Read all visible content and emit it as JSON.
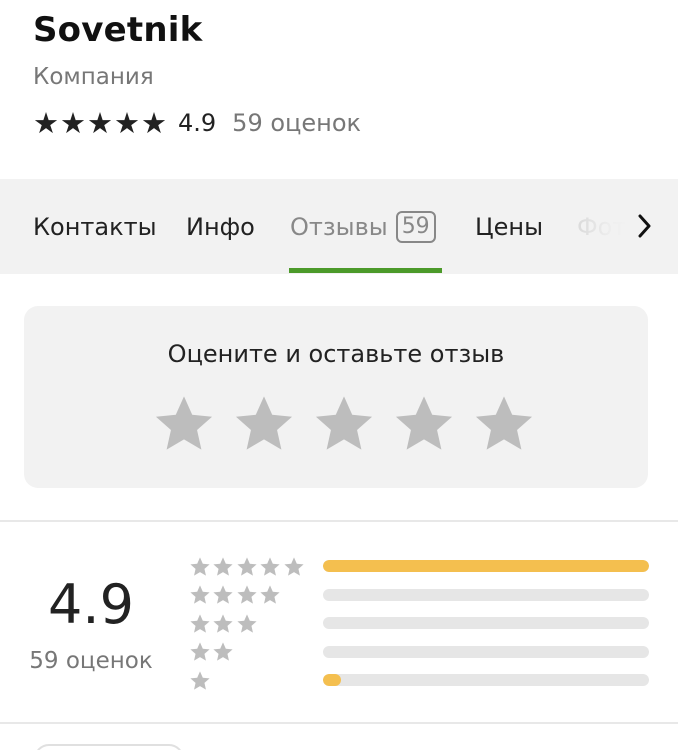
{
  "company": {
    "name": "Sovetnik",
    "category": "Компания",
    "rating": "4.9",
    "ratings_count_label": "59 оценок"
  },
  "tabs": [
    {
      "label": "Контакты",
      "active": false
    },
    {
      "label": "Инфо",
      "active": false
    },
    {
      "label": "Отзывы",
      "badge": "59",
      "active": true
    },
    {
      "label": "Цены",
      "active": false
    },
    {
      "label": "Фото",
      "active": false
    }
  ],
  "rate_prompt": {
    "title": "Оцените и оставьте отзыв",
    "stars": 5
  },
  "summary": {
    "rating": "4.9",
    "count_label": "59 оценок"
  },
  "distribution": [
    {
      "stars": 5,
      "fraction": 1.0
    },
    {
      "stars": 4,
      "fraction": 0.0
    },
    {
      "stars": 3,
      "fraction": 0.0
    },
    {
      "stars": 2,
      "fraction": 0.0
    },
    {
      "stars": 1,
      "fraction": 0.055
    }
  ],
  "colors": {
    "accent_green": "#4c9a2a",
    "bar_fill": "#f4bf4f",
    "bar_track": "#e6e6e6",
    "star_gray": "#bdbdbd",
    "star_black": "#222222"
  },
  "icons": {
    "tab_next": "chevron-right-icon",
    "rating_star": "star-icon"
  }
}
